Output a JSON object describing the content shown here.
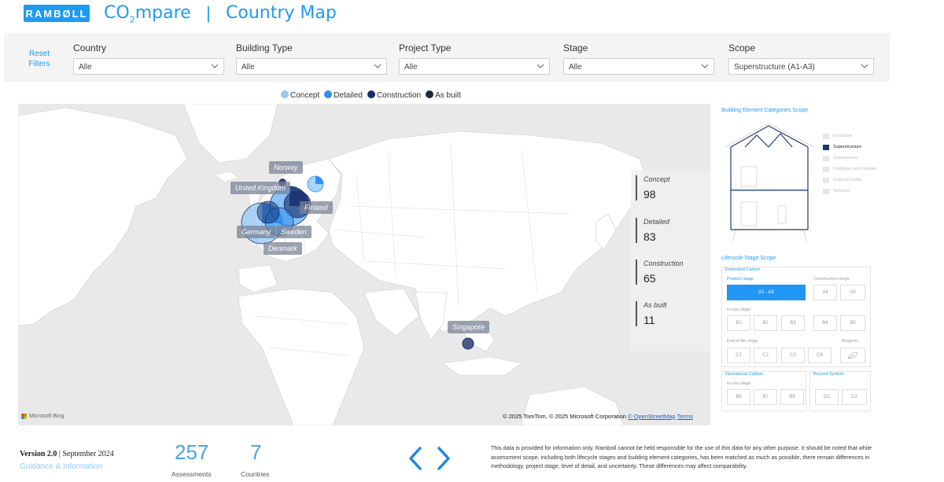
{
  "header": {
    "logo_text": "RAMBØLL",
    "app_title_prefix": "CO",
    "app_title_sub": "2",
    "app_title_suffix": "mpare",
    "separator": "|",
    "page_name": "Country Map"
  },
  "filters": {
    "reset_label": "Reset Filters",
    "country": {
      "label": "Country",
      "value": "Alle"
    },
    "building_type": {
      "label": "Building Type",
      "value": "Alle"
    },
    "project_type": {
      "label": "Project Type",
      "value": "Alle"
    },
    "stage": {
      "label": "Stage",
      "value": "Alle"
    },
    "scope": {
      "label": "Scope",
      "value": "Superstructure (A1-A3)"
    }
  },
  "legend": {
    "items": [
      {
        "label": "Concept",
        "color": "#90caf9"
      },
      {
        "label": "Detailed",
        "color": "#2e8ff0"
      },
      {
        "label": "Construction",
        "color": "#1a2f6b"
      },
      {
        "label": "As built",
        "color": "#222a3a"
      }
    ]
  },
  "map": {
    "labels": {
      "norway": "Norway",
      "united_kingdom": "United Kingdom",
      "finland": "Finland",
      "germany": "Germany",
      "sweden": "Sweden",
      "denmark": "Denmark",
      "singapore": "Singapore"
    },
    "bing_label": "Microsoft Bing",
    "attribution_text": "© 2025 TomTom, © 2025 Microsoft Corporation",
    "attribution_osm": "© OpenStreetMap",
    "attribution_terms": "Terms"
  },
  "kpis": {
    "concept": {
      "label": "Concept",
      "value": "98"
    },
    "detailed": {
      "label": "Detailed",
      "value": "83"
    },
    "construction": {
      "label": "Construction",
      "value": "65"
    },
    "as_built": {
      "label": "As built",
      "value": "11"
    }
  },
  "scope_panel": {
    "title": "Building Element Categories Scope",
    "categories": [
      {
        "label": "Enclosure",
        "active": false
      },
      {
        "label": "Superstructure",
        "active": true
      },
      {
        "label": "Substructure",
        "active": false
      },
      {
        "label": "Partitions and Finishes",
        "active": false
      },
      {
        "label": "External works",
        "active": false
      },
      {
        "label": "Services",
        "active": false
      }
    ]
  },
  "lifecycle": {
    "title": "Lifecycle Stage Scope",
    "embodied_label": "Embodied Carbon",
    "product_stage": "Product stage",
    "construction_stage": "Construction stage",
    "in_use_stage": "In-use stage",
    "end_of_life_stage": "End of life stage",
    "biogenic": "Biogenic",
    "operational_label": "Operational Carbon",
    "operational_in_use": "In-use stage",
    "beyond_system": "Beyond System",
    "buttons": {
      "a1a3": "A1 - A3",
      "a4": "A4",
      "a5": "A5",
      "b1": "B1",
      "b2": "B2",
      "b3": "B3",
      "b4": "B4",
      "b5": "B5",
      "c1": "C1",
      "c2": "C2",
      "c3": "C3",
      "c4": "C4",
      "b6": "B6",
      "b7": "B7",
      "b8": "B8",
      "d1": "D1",
      "d2": "D2"
    }
  },
  "footer": {
    "version": "Version 2.0",
    "version_date": "September 2024",
    "guidance": "Guidance & Information",
    "assessments_value": "257",
    "assessments_label": "Assessments",
    "countries_value": "7",
    "countries_label": "Countries",
    "disclaimer": "This data is provided for information only. Ramboll cannot be held responsible for the use of this data for any other purpose. It should be noted that while assessment scope, including both lifecycle stages and building element categories, has been matched as much as possible, there remain differences in methodology, project stage, level of detail, and uncertainty. These differences may affect comparability."
  }
}
